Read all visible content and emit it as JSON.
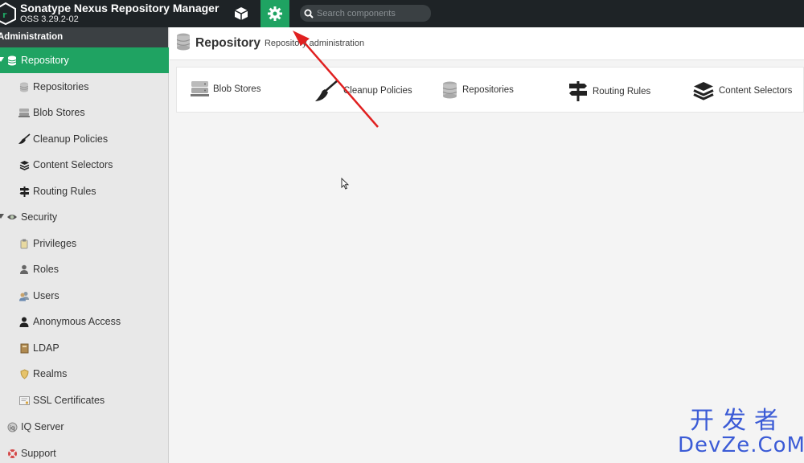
{
  "topbar": {
    "title": "Sonatype Nexus Repository Manager",
    "version": "OSS 3.29.2-02",
    "search_placeholder": "Search components"
  },
  "sidebar": {
    "header": "Administration",
    "items": [
      {
        "label": "Repository",
        "icon": "database-icon",
        "level": "top",
        "active": true,
        "expanded": true
      },
      {
        "label": "Repositories",
        "icon": "database-icon",
        "level": "child"
      },
      {
        "label": "Blob Stores",
        "icon": "server-icon",
        "level": "child"
      },
      {
        "label": "Cleanup Policies",
        "icon": "broom-icon",
        "level": "child"
      },
      {
        "label": "Content Selectors",
        "icon": "layers-icon",
        "level": "child"
      },
      {
        "label": "Routing Rules",
        "icon": "signpost-icon",
        "level": "child"
      },
      {
        "label": "Security",
        "icon": "eye-icon",
        "level": "top",
        "expanded": true
      },
      {
        "label": "Privileges",
        "icon": "badge-icon",
        "level": "child"
      },
      {
        "label": "Roles",
        "icon": "role-icon",
        "level": "child"
      },
      {
        "label": "Users",
        "icon": "users-icon",
        "level": "child"
      },
      {
        "label": "Anonymous Access",
        "icon": "user-icon",
        "level": "child"
      },
      {
        "label": "LDAP",
        "icon": "book-icon",
        "level": "child"
      },
      {
        "label": "Realms",
        "icon": "shield-icon",
        "level": "child"
      },
      {
        "label": "SSL Certificates",
        "icon": "certificate-icon",
        "level": "child"
      },
      {
        "label": "IQ Server",
        "icon": "iq-icon",
        "level": "top"
      },
      {
        "label": "Support",
        "icon": "lifebuoy-icon",
        "level": "top"
      }
    ]
  },
  "main": {
    "title": "Repository",
    "subtitle": "Repository administration",
    "tiles": [
      {
        "label": "Blob Stores",
        "icon": "server-icon"
      },
      {
        "label": "Cleanup Policies",
        "icon": "broom-icon"
      },
      {
        "label": "Repositories",
        "icon": "database-icon"
      },
      {
        "label": "Routing Rules",
        "icon": "signpost-icon"
      },
      {
        "label": "Content Selectors",
        "icon": "layers-icon"
      }
    ]
  },
  "watermark": {
    "chinese": "开发者",
    "latin": "DevZe.CoM"
  },
  "colors": {
    "accent": "#1fa362",
    "topbar": "#1e2326",
    "sidebar_bg": "#e8e8e8",
    "annotation_arrow": "#e02020",
    "watermark": "#3b5bd6"
  }
}
